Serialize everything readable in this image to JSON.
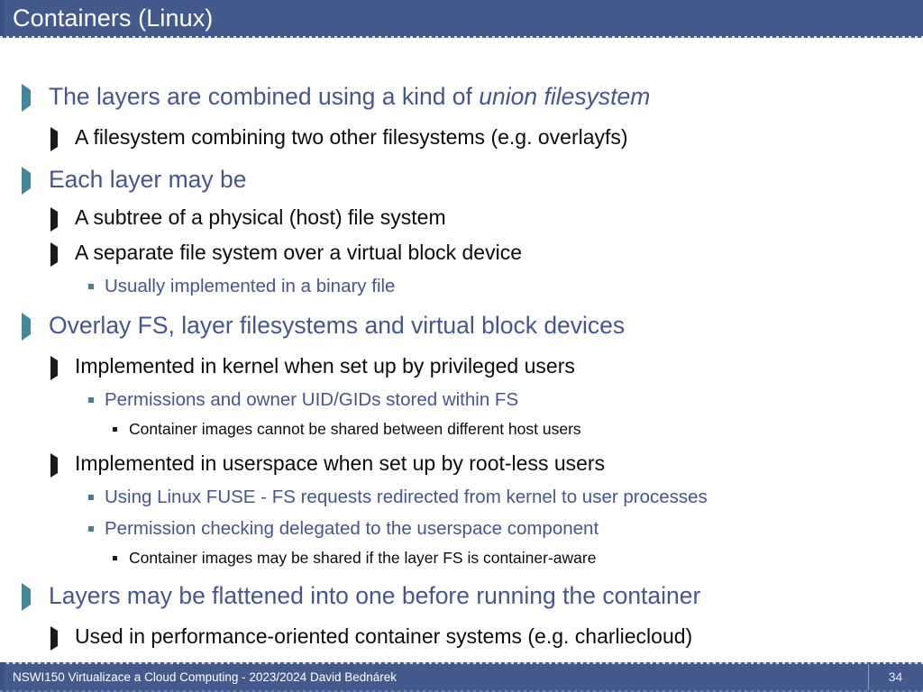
{
  "slide": {
    "title": "Containers (Linux)",
    "theme": {
      "header_bg": "#44598c",
      "header_text": "#ffffff",
      "level1_text": "#45568e",
      "level1_bullet": "#41889a",
      "level2_text": "#0c0c0c",
      "level2_bullet": "#1a1a1a",
      "level3_text": "#45568e",
      "level3_bullet": "#4f7d8c",
      "level4_text": "#0c0c0c",
      "level4_bullet": "#1a1a1a",
      "footer_bg": "#44598c",
      "background": "#ffffff"
    },
    "bullets": [
      {
        "level": 1,
        "text_before": "The layers are combined using a kind of ",
        "text_italic": "union filesystem",
        "text_after": "",
        "bullet_glyph": "triangle-right"
      },
      {
        "level": 2,
        "text": "A filesystem combining two other filesystems (e.g. overlayfs)",
        "bullet_glyph": "triangle-right"
      },
      {
        "level": 1,
        "text": "Each layer may be",
        "bullet_glyph": "triangle-right"
      },
      {
        "level": 2,
        "text": "A subtree of a physical (host) file system",
        "bullet_glyph": "triangle-right"
      },
      {
        "level": 2,
        "text": "A separate file system over a virtual block device",
        "bullet_glyph": "triangle-right"
      },
      {
        "level": 3,
        "text": "Usually implemented in a binary file",
        "bullet_glyph": "square"
      },
      {
        "level": 1,
        "text": "Overlay FS, layer filesystems and virtual block devices",
        "bullet_glyph": "triangle-right"
      },
      {
        "level": 2,
        "text": "Implemented in kernel when set up by privileged users",
        "bullet_glyph": "triangle-right"
      },
      {
        "level": 3,
        "text": "Permissions and owner UID/GIDs stored within FS",
        "bullet_glyph": "square"
      },
      {
        "level": 4,
        "text": "Container images cannot be shared between different host users",
        "bullet_glyph": "square"
      },
      {
        "level": 2,
        "text": "Implemented in userspace when set up by root-less users",
        "bullet_glyph": "triangle-right"
      },
      {
        "level": 3,
        "text": "Using Linux FUSE - FS requests redirected from kernel to user processes",
        "bullet_glyph": "square"
      },
      {
        "level": 3,
        "text": "Permission checking delegated to the userspace component",
        "bullet_glyph": "square"
      },
      {
        "level": 4,
        "text": "Container images may be shared if the layer FS is container-aware",
        "bullet_glyph": "square"
      },
      {
        "level": 1,
        "text": "Layers may be flattened into one before running the container",
        "bullet_glyph": "triangle-right"
      },
      {
        "level": 2,
        "text": "Used in performance-oriented container systems (e.g. charliecloud)",
        "bullet_glyph": "triangle-right"
      }
    ]
  },
  "footer": {
    "text": "NSWI150 Virtualizace a Cloud Computing - 2023/2024 David Bednárek",
    "page_number": "34"
  }
}
